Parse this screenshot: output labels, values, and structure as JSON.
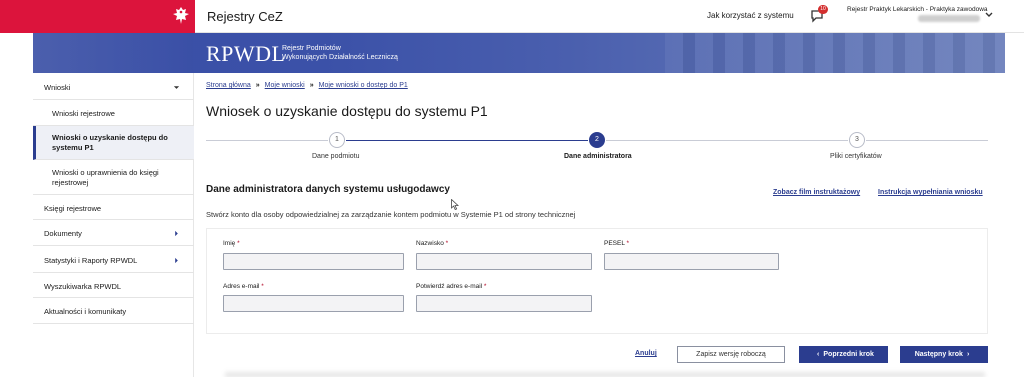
{
  "header": {
    "app_name": "Rejestry CeZ",
    "how_to_link": "Jak korzystać z systemu",
    "notification_count": "10",
    "user_registry": "Rejestr Praktyk Lekarskich - Praktyka zawodowa",
    "brand_color": "#dc143c"
  },
  "banner": {
    "title": "RPWDL",
    "subtitle_line1": "Rejestr Podmiotów",
    "subtitle_line2": "Wykonujących Działalność Leczniczą"
  },
  "sidebar": {
    "items": [
      {
        "label": "Wnioski",
        "icon": "chevron-down-icon"
      },
      {
        "label": "Wnioski rejestrowe"
      },
      {
        "label_line1": "Wnioski o uzyskanie dostępu do",
        "label_line2": "systemu P1"
      },
      {
        "label_line1": "Wnioski o uprawnienia do księgi",
        "label_line2": "rejestrowej"
      },
      {
        "label": "Księgi rejestrowe"
      },
      {
        "label": "Dokumenty",
        "icon": "chevron-right-icon"
      },
      {
        "label": "Statystyki i Raporty RPWDL",
        "icon": "chevron-right-icon"
      },
      {
        "label": "Wyszukiwarka RPWDL"
      },
      {
        "label": "Aktualności i komunikaty"
      }
    ]
  },
  "breadcrumb": {
    "items": [
      "Strona główna",
      "Moje wnioski",
      "Moje wnioski o dostęp do P1"
    ]
  },
  "page": {
    "title": "Wniosek o uzyskanie dostępu do systemu P1"
  },
  "stepper": {
    "steps": [
      {
        "number": "1",
        "label": "Dane podmiotu"
      },
      {
        "number": "2",
        "label": "Dane administratora"
      },
      {
        "number": "3",
        "label": "Pliki certyfikatów"
      }
    ],
    "active_step": 2
  },
  "section": {
    "title": "Dane administratora danych systemu usługodawcy",
    "film_link": "Zobacz film instruktażowy",
    "instruction_link": "Instrukcja wypełniania wniosku",
    "description": "Stwórz konto dla osoby odpowiedzialnej za zarządzanie kontem podmiotu w Systemie P1 od strony technicznej"
  },
  "form": {
    "first_name_label": "Imię",
    "last_name_label": "Nazwisko",
    "pesel_label": "PESEL",
    "email_label": "Adres e-mail",
    "email_confirm_label": "Potwierdź adres e-mail",
    "required_mark": "*"
  },
  "actions": {
    "cancel": "Anuluj",
    "save_draft": "Zapisz wersję roboczą",
    "prev": "Poprzedni krok",
    "next": "Następny krok"
  },
  "colors": {
    "accent": "#2b3d8f",
    "banner": "#3a4fa6"
  }
}
